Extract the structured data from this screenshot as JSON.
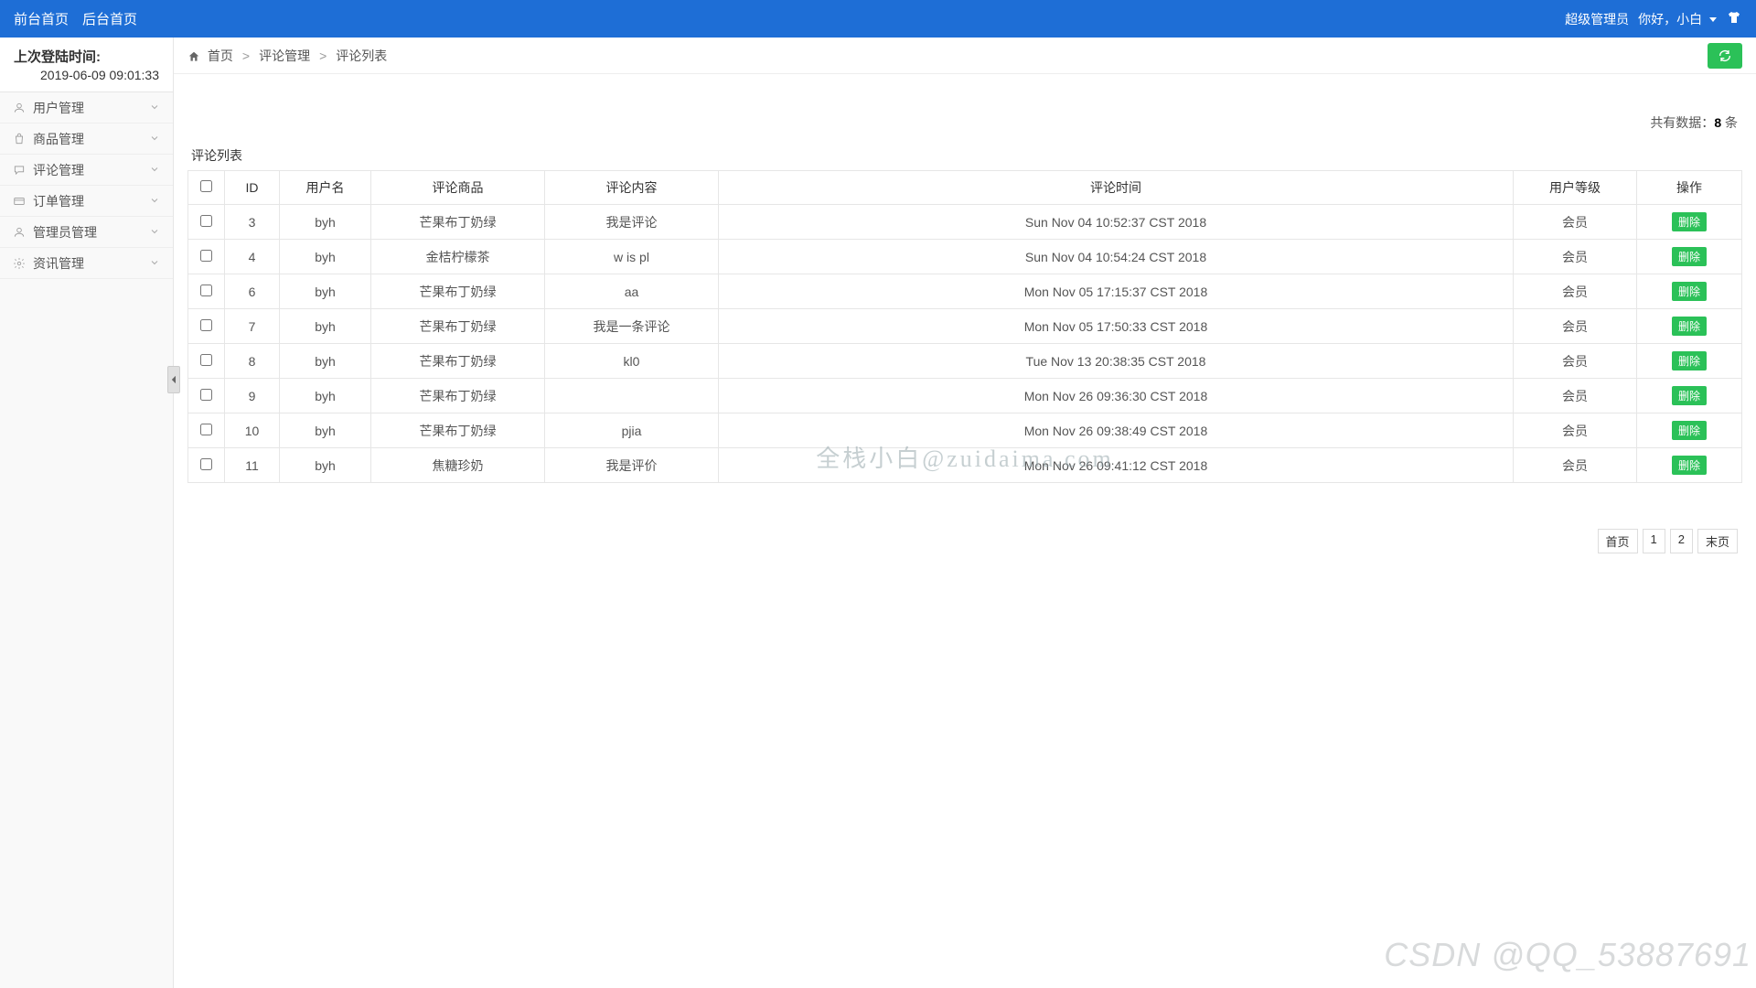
{
  "topbar": {
    "front_link": "前台首页",
    "back_link": "后台首页",
    "role": "超级管理员",
    "greeting": "你好，小白"
  },
  "sidebar": {
    "login_label": "上次登陆时间:",
    "login_value": "2019-06-09 09:01:33",
    "items": [
      {
        "label": "用户管理",
        "icon": "user"
      },
      {
        "label": "商品管理",
        "icon": "bag"
      },
      {
        "label": "评论管理",
        "icon": "comment"
      },
      {
        "label": "订单管理",
        "icon": "card"
      },
      {
        "label": "管理员管理",
        "icon": "admin"
      },
      {
        "label": "资讯管理",
        "icon": "gear"
      }
    ]
  },
  "breadcrumb": {
    "home": "首页",
    "level1": "评论管理",
    "level2": "评论列表",
    "sep": ">"
  },
  "summary": {
    "prefix": "共有数据：",
    "count": "8",
    "suffix": " 条"
  },
  "table": {
    "title": "评论列表",
    "headers": {
      "id": "ID",
      "username": "用户名",
      "product": "评论商品",
      "content": "评论内容",
      "time": "评论时间",
      "level": "用户等级",
      "action": "操作"
    },
    "delete_label": "删除",
    "rows": [
      {
        "id": "3",
        "user": "byh",
        "product": "芒果布丁奶绿",
        "content": "我是评论",
        "time": "Sun Nov 04 10:52:37 CST 2018",
        "level": "会员"
      },
      {
        "id": "4",
        "user": "byh",
        "product": "金桔柠檬茶",
        "content": "w is pl",
        "time": "Sun Nov 04 10:54:24 CST 2018",
        "level": "会员"
      },
      {
        "id": "6",
        "user": "byh",
        "product": "芒果布丁奶绿",
        "content": "aa",
        "time": "Mon Nov 05 17:15:37 CST 2018",
        "level": "会员"
      },
      {
        "id": "7",
        "user": "byh",
        "product": "芒果布丁奶绿",
        "content": "我是一条评论",
        "time": "Mon Nov 05 17:50:33 CST 2018",
        "level": "会员"
      },
      {
        "id": "8",
        "user": "byh",
        "product": "芒果布丁奶绿",
        "content": "kl0",
        "time": "Tue Nov 13 20:38:35 CST 2018",
        "level": "会员"
      },
      {
        "id": "9",
        "user": "byh",
        "product": "芒果布丁奶绿",
        "content": "",
        "time": "Mon Nov 26 09:36:30 CST 2018",
        "level": "会员"
      },
      {
        "id": "10",
        "user": "byh",
        "product": "芒果布丁奶绿",
        "content": "pjia",
        "time": "Mon Nov 26 09:38:49 CST 2018",
        "level": "会员"
      },
      {
        "id": "11",
        "user": "byh",
        "product": "焦糖珍奶",
        "content": "我是评价",
        "time": "Mon Nov 26 09:41:12 CST 2018",
        "level": "会员"
      }
    ]
  },
  "pagination": {
    "first": "首页",
    "pages": [
      "1",
      "2"
    ],
    "last": "末页"
  },
  "watermarks": {
    "center": "全栈小白@zuidaima.com",
    "bottom": "CSDN @QQ_53887691"
  }
}
